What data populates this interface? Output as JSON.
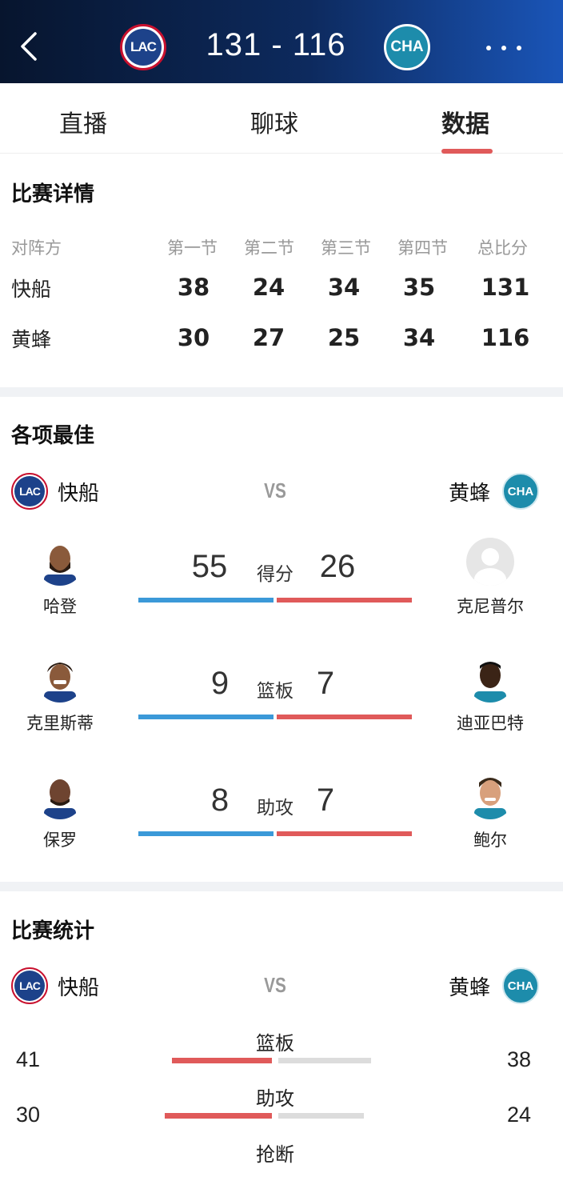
{
  "header": {
    "home_logo": "LAC",
    "away_logo": "CHA",
    "score": "131 - 116"
  },
  "tabs": [
    {
      "label": "直播"
    },
    {
      "label": "聊球"
    },
    {
      "label": "数据"
    }
  ],
  "match_details": {
    "title": "比赛详情",
    "columns": [
      "对阵方",
      "第一节",
      "第二节",
      "第三节",
      "第四节",
      "总比分"
    ],
    "rows": [
      {
        "team": "快船",
        "q1": "38",
        "q2": "24",
        "q3": "34",
        "q4": "35",
        "total": "131"
      },
      {
        "team": "黄蜂",
        "q1": "30",
        "q2": "27",
        "q3": "25",
        "q4": "34",
        "total": "116"
      }
    ]
  },
  "leaders": {
    "title": "各项最佳",
    "home_team": "快船",
    "away_team": "黄蜂",
    "vs": "VS",
    "items": [
      {
        "category": "得分",
        "home_player": "哈登",
        "home_value": "55",
        "away_player": "克尼普尔",
        "away_value": "26"
      },
      {
        "category": "篮板",
        "home_player": "克里斯蒂",
        "home_value": "9",
        "away_player": "迪亚巴特",
        "away_value": "7"
      },
      {
        "category": "助攻",
        "home_player": "保罗",
        "home_value": "8",
        "away_player": "鲍尔",
        "away_value": "7"
      }
    ]
  },
  "game_stats": {
    "title": "比赛统计",
    "home_team": "快船",
    "away_team": "黄蜂",
    "vs": "VS",
    "items": [
      {
        "label": "篮板",
        "home": "41",
        "away": "38"
      },
      {
        "label": "助攻",
        "home": "30",
        "away": "24"
      },
      {
        "label": "抢断",
        "home": "",
        "away": ""
      }
    ]
  },
  "colors": {
    "home_accent": "#3b99d8",
    "away_accent": "#e05a5a",
    "tab_indicator": "#e05a5a"
  },
  "icons": [
    "back-arrow-icon",
    "more-dots-icon",
    "team-logo-icon",
    "player-avatar-icon"
  ]
}
